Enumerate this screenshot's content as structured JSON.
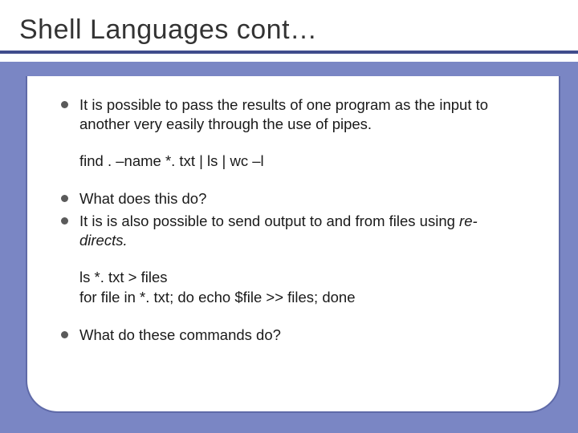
{
  "title": "Shell Languages cont…",
  "items": {
    "b1": "It is possible to pass the results of one program as the input to another very easily through the use of pipes.",
    "code1": "find . –name *. txt | ls | wc –l",
    "b2": "What does this do?",
    "b3_prefix": "It is is also possible to send output to and from files using ",
    "b3_italic": "re-directs.",
    "code2_line1": "ls *. txt > files",
    "code2_line2": "for file in *. txt; do echo $file >> files; done",
    "b4": "What do these commands do?"
  }
}
